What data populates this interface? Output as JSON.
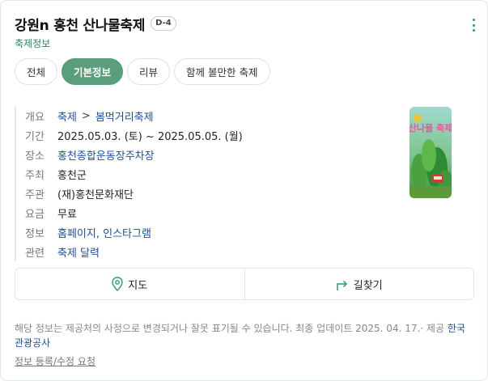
{
  "header": {
    "title": "강원n 홍천 산나물축제",
    "badge": "D-4",
    "subtitle": "축제정보"
  },
  "tabs": [
    {
      "label": "전체",
      "active": false
    },
    {
      "label": "기본정보",
      "active": true
    },
    {
      "label": "리뷰",
      "active": false
    },
    {
      "label": "함께 볼만한 축제",
      "active": false
    }
  ],
  "info": {
    "overview": {
      "label": "개요",
      "category": "축제",
      "separator": ">",
      "subcategory": "봄먹거리축제"
    },
    "period": {
      "label": "기간",
      "value": "2025.05.03. (토) ~  2025.05.05. (월)"
    },
    "place": {
      "label": "장소",
      "value": "홍천종합운동장주차장"
    },
    "host": {
      "label": "주최",
      "value": "홍천군"
    },
    "organizer": {
      "label": "주관",
      "value": "(재)홍천문화재단"
    },
    "fee": {
      "label": "요금",
      "value": "무료"
    },
    "links": {
      "label": "정보",
      "value": "홈페이지, 인스타그램"
    },
    "related": {
      "label": "관련",
      "value": "축제 달력"
    }
  },
  "poster": {
    "text": "산나물 축제"
  },
  "actions": {
    "map_label": "지도",
    "directions_label": "길찾기"
  },
  "footer": {
    "notice": "해당 정보는 제공처의 사정으로 변경되거나 잘못 표기될 수 있습니다. 최종 업데이트 2025. 04. 17.· 제공",
    "source": "한국관광공사",
    "edit_link": "정보 등록/수정 요청"
  },
  "colors": {
    "accent": "#5b9e7c",
    "link": "#1b4f9c",
    "subtitle": "#1f8a5b"
  }
}
